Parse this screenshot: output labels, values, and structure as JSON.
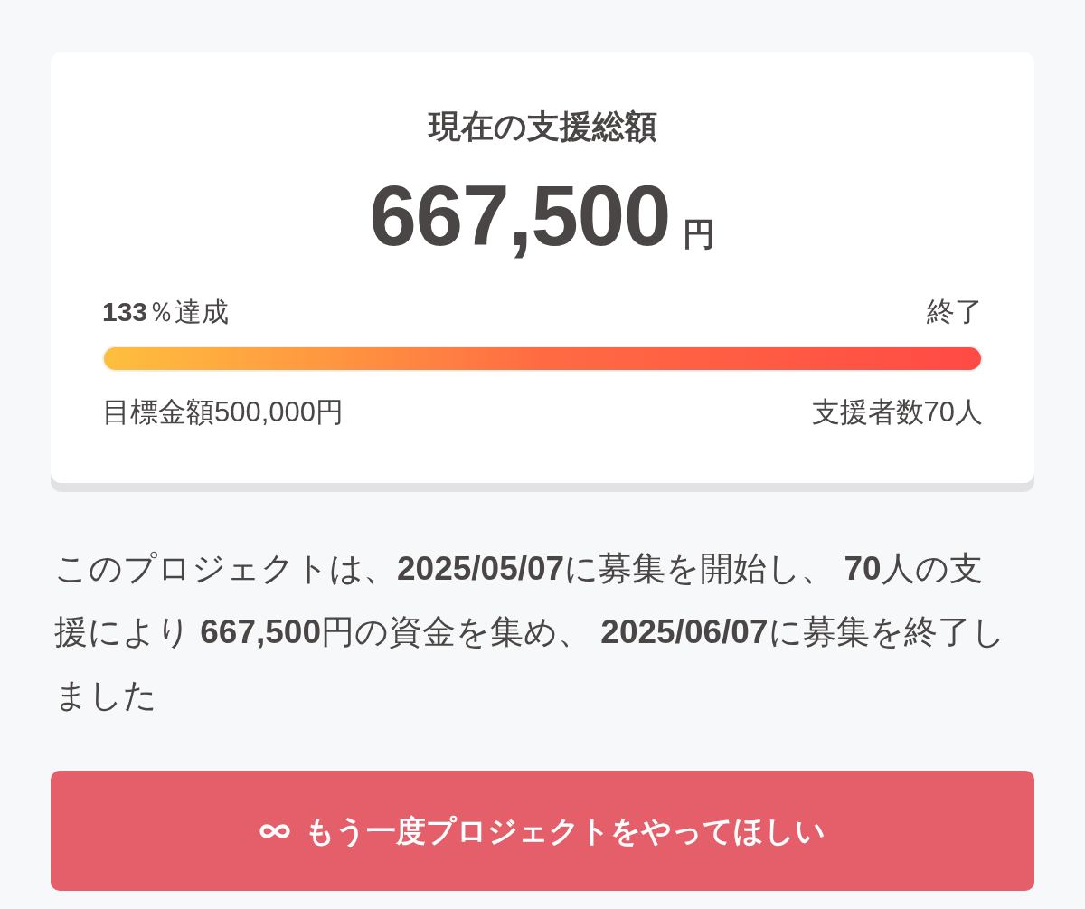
{
  "summary": {
    "title": "現在の支援総額",
    "amount": "667,500",
    "currency": "円",
    "achievement": "**133**％達成",
    "status": "終了",
    "progress": {
      "level": 1
    },
    "goal": "目標金額500,000円",
    "backers": "支援者数70人"
  },
  "description": "このプロジェクトは、**2025/05/07**に募集を開始し、 **70**人の支援により **667,500**円の資金を集め、 **2025/06/07**に募集を終了しました",
  "button": {
    "label": "もう一度プロジェクトをやってほしい"
  }
}
